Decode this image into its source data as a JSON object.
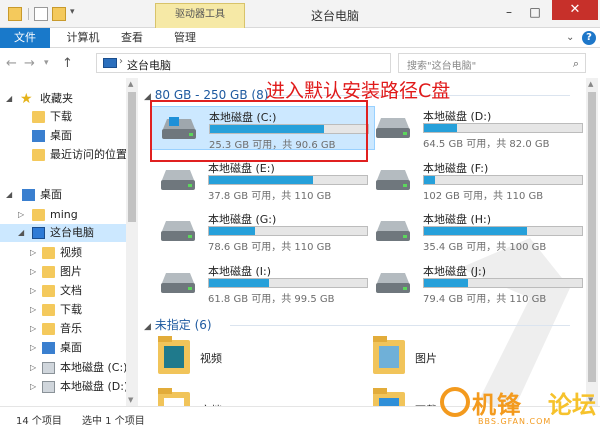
{
  "window": {
    "title": "这台电脑",
    "tools_tab": "驱动器工具",
    "minimize": "–",
    "maximize": "□",
    "close": "✕"
  },
  "ribbon": {
    "tabs": [
      "文件",
      "计算机",
      "查看",
      "管理"
    ],
    "help": "?"
  },
  "address": {
    "path": "这台电脑",
    "search_placeholder": "搜索\"这台电脑\""
  },
  "nav": {
    "favorites": "收藏夹",
    "downloads": "下载",
    "desktop": "桌面",
    "recent": "最近访问的位置",
    "desktop_root": "桌面",
    "user": "ming",
    "this_pc": "这台电脑",
    "items": [
      "视频",
      "图片",
      "文档",
      "下载",
      "音乐",
      "桌面",
      "本地磁盘 (C:)",
      "本地磁盘 (D:)"
    ]
  },
  "content": {
    "group1": "80 GB - 250 GB (8)",
    "group2": "未指定 (6)",
    "annotation": "进入默认安装路径C盘",
    "drives": [
      {
        "name": "本地磁盘 (C:)",
        "free": "25.3 GB 可用，共 90.6 GB",
        "used_fraction": 0.72
      },
      {
        "name": "本地磁盘 (D:)",
        "free": "64.5 GB 可用，共 82.0 GB",
        "used_fraction": 0.21
      },
      {
        "name": "本地磁盘 (E:)",
        "free": "37.8 GB 可用，共 110 GB",
        "used_fraction": 0.66
      },
      {
        "name": "本地磁盘 (F:)",
        "free": "102 GB 可用，共 110 GB",
        "used_fraction": 0.07
      },
      {
        "name": "本地磁盘 (G:)",
        "free": "78.6 GB 可用，共 110 GB",
        "used_fraction": 0.29
      },
      {
        "name": "本地磁盘 (H:)",
        "free": "35.4 GB 可用，共 100 GB",
        "used_fraction": 0.65
      },
      {
        "name": "本地磁盘 (I:)",
        "free": "61.8 GB 可用，共 99.5 GB",
        "used_fraction": 0.38
      },
      {
        "name": "本地磁盘 (J:)",
        "free": "79.4 GB 可用，共 110 GB",
        "used_fraction": 0.28
      }
    ],
    "folders": [
      "视频",
      "图片",
      "文档",
      "下载"
    ]
  },
  "status": {
    "count": "14 个项目",
    "selected": "选中 1 个项目"
  },
  "watermark": {
    "name1": "机锋",
    "name2": "论坛",
    "url": "BBS.GFAN.COM"
  },
  "colors": {
    "accent": "#1979ca",
    "bar": "#26a0da",
    "annotation": "#e01a1a"
  }
}
